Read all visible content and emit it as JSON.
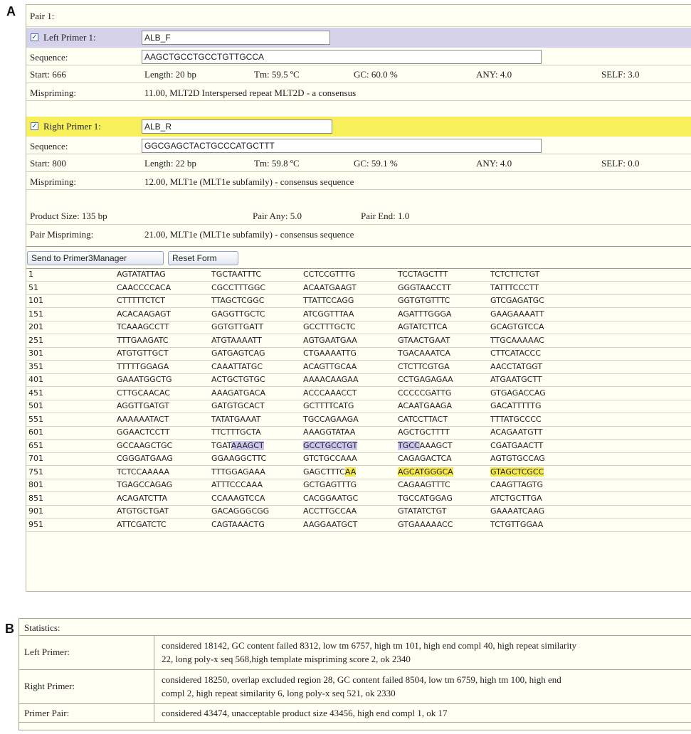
{
  "panel_labels": {
    "a": "A",
    "b": "B"
  },
  "pair": {
    "title": "Pair 1:",
    "left": {
      "checkbox": "✓",
      "label": "Left Primer 1:",
      "name": "ALB_F",
      "sequence_label": "Sequence:",
      "sequence": "AAGCTGCCTGCCTGTTGCCA",
      "start": "Start:  666",
      "length": "Length:  20 bp",
      "tm": "Tm:  59.5 ºC",
      "gc": "GC:  60.0 %",
      "any": "ANY:  4.0",
      "self": "SELF:  3.0",
      "mispriming_label": "Mispriming:",
      "mispriming": "11.00, MLT2D Interspersed repeat MLT2D - a consensus"
    },
    "right": {
      "checkbox": "✓",
      "label": "Right Primer 1:",
      "name": "ALB_R",
      "sequence_label": "Sequence:",
      "sequence": "GGCGAGCTACTGCCCATGCTTT",
      "start": "Start:  800",
      "length": "Length:  22 bp",
      "tm": "Tm:  59.8 ºC",
      "gc": "GC:  59.1 %",
      "any": "ANY:  4.0",
      "self": "SELF:  0.0",
      "mispriming_label": "Mispriming:",
      "mispriming": "12.00, MLT1e (MLT1e subfamily) - consensus sequence"
    },
    "product_size": "Product Size:  135 bp",
    "pair_any": "Pair Any: 5.0",
    "pair_end": "Pair End: 1.0",
    "pair_mispriming_label": "Pair Mispriming:",
    "pair_mispriming": "21.00, MLT1e (MLT1e subfamily) - consensus sequence"
  },
  "buttons": {
    "send": "Send to Primer3Manager",
    "reset": "Reset Form"
  },
  "sequence_rows": [
    {
      "num": "1",
      "cols": [
        "AGTATATTAG",
        "TGCTAATTTC",
        "CCTCCGTTTG",
        "TCCTAGCTTT",
        "TCTCTTCTGT"
      ]
    },
    {
      "num": "51",
      "cols": [
        "CAACCCCACA",
        "CGCCTTTGGC",
        "ACAATGAAGT",
        "GGGTAACCTT",
        "TATTTCCCTT"
      ]
    },
    {
      "num": "101",
      "cols": [
        "CTTTTTCTCT",
        "TTAGCTCGGC",
        "TTATTCCAGG",
        "GGTGTGTTTC",
        "GTCGAGATGC"
      ]
    },
    {
      "num": "151",
      "cols": [
        "ACACAAGAGT",
        "GAGGTTGCTC",
        "ATCGGTTTAA",
        "AGATTTGGGA",
        "GAAGAAAATT"
      ]
    },
    {
      "num": "201",
      "cols": [
        "TCAAAGCCTT",
        "GGTGTTGATT",
        "GCCTTTGCTC",
        "AGTATCTTCA",
        "GCAGTGTCCA"
      ]
    },
    {
      "num": "251",
      "cols": [
        "TTTGAAGATC",
        "ATGTAAAATT",
        "AGTGAATGAA",
        "GTAACTGAAT",
        "TTGCAAAAAC"
      ]
    },
    {
      "num": "301",
      "cols": [
        "ATGTGTTGCT",
        "GATGAGTCAG",
        "CTGAAAATTG",
        "TGACAAATCA",
        "CTTCATACCC"
      ]
    },
    {
      "num": "351",
      "cols": [
        "TTTTTGGAGA",
        "CAAATTATGC",
        "ACAGTTGCAA",
        "CTCTTCGTGA",
        "AACCTATGGT"
      ]
    },
    {
      "num": "401",
      "cols": [
        "GAAATGGCTG",
        "ACTGCTGTGC",
        "AAAACAAGAA",
        "CCTGAGAGAA",
        "ATGAATGCTT"
      ]
    },
    {
      "num": "451",
      "cols": [
        "CTTGCAACAC",
        "AAAGATGACA",
        "ACCCAAACCT",
        "CCCCCGATTG",
        "GTGAGACCAG"
      ]
    },
    {
      "num": "501",
      "cols": [
        "AGGTTGATGT",
        "GATGTGCACT",
        "GCTTTTCATG",
        "ACAATGAAGA",
        "GACATTTTTG"
      ]
    },
    {
      "num": "551",
      "cols": [
        "AAAAAATACT",
        "TATATGAAAT",
        "TGCCAGAAGA",
        "CATCCTTACT",
        "TTTATGCCCC"
      ]
    },
    {
      "num": "601",
      "cols": [
        "GGAACTCCTT",
        "TTCTTTGCTA",
        "AAAGGTATAA",
        "AGCTGCTTTT",
        "ACAGAATGTT"
      ]
    },
    {
      "num": "651",
      "cols": [
        "GCCAAGCTGC",
        "TGATAAAGCT",
        "GCCTGCCTGT",
        "TGCCAAAGCT",
        "CGATGAACTT"
      ]
    },
    {
      "num": "701",
      "cols": [
        "CGGGATGAAG",
        "GGAAGGCTTC",
        "GTCTGCCAAA",
        "CAGAGACTCA",
        "AGTGTGCCAG"
      ]
    },
    {
      "num": "751",
      "cols": [
        "TCTCCAAAAA",
        "TTTGGAGAAA",
        "GAGCTTTCAA",
        "AGCATGGGCA",
        "GTAGCTCGCC"
      ]
    },
    {
      "num": "801",
      "cols": [
        "TGAGCCAGAG",
        "ATTTCCCAAA",
        "GCTGAGTTTG",
        "CAGAAGTTTC",
        "CAAGTTAGTG"
      ]
    },
    {
      "num": "851",
      "cols": [
        "ACAGATCTTA",
        "CCAAAGTCCA",
        "CACGGAATGC",
        "TGCCATGGAG",
        "ATCTGCTTGA"
      ]
    },
    {
      "num": "901",
      "cols": [
        "ATGTGCTGAT",
        "GACAGGGCGG",
        "ACCTTGCCAA",
        "GTATATCTGT",
        "GAAAATCAAG"
      ]
    },
    {
      "num": "951",
      "cols": [
        "ATTCGATCTC",
        "CAGTAAACTG",
        "AAGGAATGCT",
        "GTGAAAAACC",
        "TCTGTTGGAA"
      ]
    }
  ],
  "statistics": {
    "title": "Statistics:",
    "left_label": "Left Primer:",
    "left_line1": "considered 18142, GC content failed 8312, low tm 6757, high tm 101, high end compl 40, high repeat similarity",
    "left_line2": "22, long poly-x seq 568,high template mispriming score 2, ok 2340",
    "right_label": "Right Primer:",
    "right_line1": "considered 18250, overlap excluded region 28, GC content failed 8504, low tm 6759, high tm 100, high end",
    "right_line2": "compl 2, high repeat similarity 6, long poly-x seq 521, ok 2330",
    "pair_label": "Primer Pair:",
    "pair_line1": "considered 43474, unacceptable product size 43456, high end compl 1, ok 17"
  }
}
